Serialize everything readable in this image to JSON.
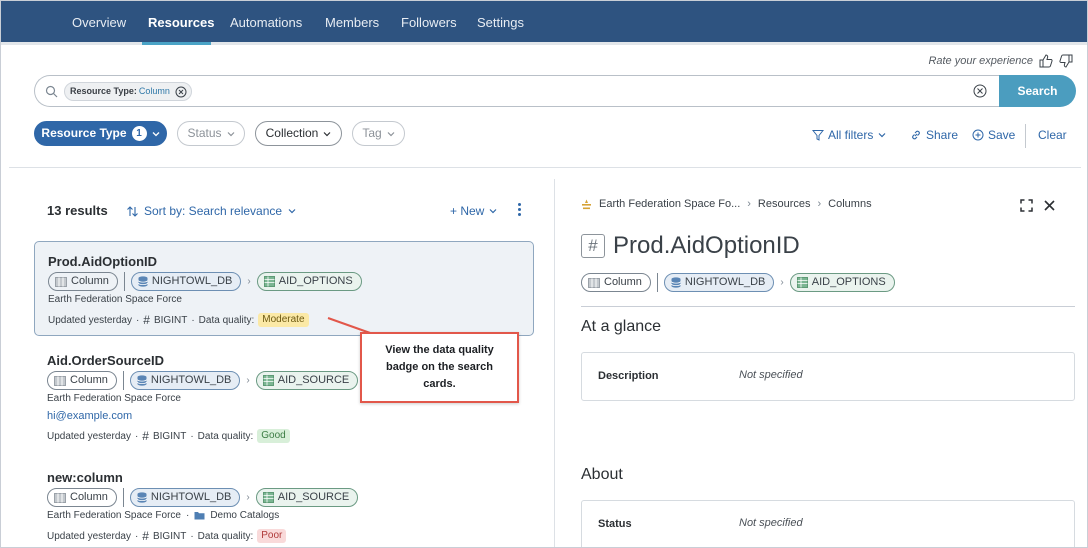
{
  "nav": {
    "tabs": [
      {
        "label": "Overview"
      },
      {
        "label": "Resources"
      },
      {
        "label": "Automations"
      },
      {
        "label": "Members"
      },
      {
        "label": "Followers"
      },
      {
        "label": "Settings"
      }
    ],
    "active_tab": "Resources"
  },
  "rate": {
    "text": "Rate your experience"
  },
  "search": {
    "chip_key": "Resource Type:",
    "chip_value": "Column",
    "button_label": "Search"
  },
  "filters": {
    "resource_type": {
      "label": "Resource Type",
      "count": "1"
    },
    "status": "Status",
    "collection": "Collection",
    "tag": "Tag",
    "all_filters": "All filters",
    "share": "Share",
    "save": "Save",
    "clear": "Clear"
  },
  "results": {
    "count_label": "13 results",
    "sort_label": "Sort by: Search relevance",
    "new_label": "+ New",
    "items": [
      {
        "title": "Prod.AidOptionID",
        "type": "Column",
        "database": "NIGHTOWL_DB",
        "table": "AID_OPTIONS",
        "org": "Earth Federation Space Force",
        "updated": "Updated yesterday",
        "datatype": "BIGINT",
        "dq_label": "Data quality:",
        "dq_value": "Moderate"
      },
      {
        "title": "Aid.OrderSourceID",
        "type": "Column",
        "database": "NIGHTOWL_DB",
        "table": "AID_SOURCE",
        "org": "Earth Federation Space Force",
        "email": "hi@example.com",
        "updated": "Updated yesterday",
        "datatype": "BIGINT",
        "dq_label": "Data quality:",
        "dq_value": "Good"
      },
      {
        "title": "new:column",
        "type": "Column",
        "database": "NIGHTOWL_DB",
        "table": "AID_SOURCE",
        "org": "Earth Federation Space Force",
        "collection": "Demo Catalogs",
        "updated": "Updated yesterday",
        "datatype": "BIGINT",
        "dq_label": "Data quality:",
        "dq_value": "Poor"
      }
    ]
  },
  "callout": {
    "text": "View the data quality badge on the search cards."
  },
  "detail": {
    "breadcrumb": [
      "Earth Federation Space Fo...",
      "Resources",
      "Columns"
    ],
    "title": "Prod.AidOptionID",
    "type": "Column",
    "database": "NIGHTOWL_DB",
    "table": "AID_OPTIONS",
    "at_a_glance": "At a glance",
    "description_label": "Description",
    "description_value": "Not specified",
    "about": "About",
    "status_label": "Status",
    "status_value": "Not specified"
  },
  "colors": {
    "nav_bg": "#2e5380",
    "accent": "#4b9dbf",
    "primary": "#2f67a8",
    "callout_border": "#e2574a"
  }
}
